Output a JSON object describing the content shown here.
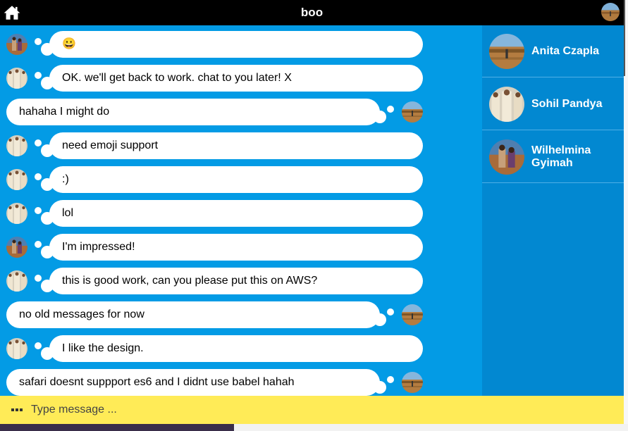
{
  "header": {
    "title": "boo",
    "home_icon": "home-icon"
  },
  "messages": [
    {
      "dir": "in",
      "text": "😀",
      "avatar": "desert"
    },
    {
      "dir": "in",
      "text": "OK. we'll get back to work. chat to you later! X",
      "avatar": "robes"
    },
    {
      "dir": "out",
      "text": "hahaha I might do",
      "avatar": "field"
    },
    {
      "dir": "in",
      "text": "need emoji support",
      "avatar": "robes"
    },
    {
      "dir": "in",
      "text": ":)",
      "avatar": "robes"
    },
    {
      "dir": "in",
      "text": "lol",
      "avatar": "robes"
    },
    {
      "dir": "in",
      "text": "I'm impressed!",
      "avatar": "desert"
    },
    {
      "dir": "in",
      "text": "this is good work, can you please put this on AWS?",
      "avatar": "robes"
    },
    {
      "dir": "out",
      "text": "no old messages for now",
      "avatar": "field"
    },
    {
      "dir": "in",
      "text": "I like the design.",
      "avatar": "robes"
    },
    {
      "dir": "out",
      "text": "safari doesnt suppport es6 and I didnt use babel hahah",
      "avatar": "field"
    }
  ],
  "contacts": [
    {
      "name": "Anita Czapla",
      "avatar": "field"
    },
    {
      "name": "Sohil Pandya",
      "avatar": "robes"
    },
    {
      "name": "Wilhelmina Gyimah",
      "avatar": "desert"
    }
  ],
  "composer": {
    "placeholder": "Type message ...",
    "more_icon": "more-dots-icon"
  },
  "colors": {
    "header_bg": "#000000",
    "chat_bg": "#039be5",
    "sidebar_bg": "#0288d1",
    "composer_bg": "#ffeb57",
    "bubble_bg": "#ffffff"
  }
}
